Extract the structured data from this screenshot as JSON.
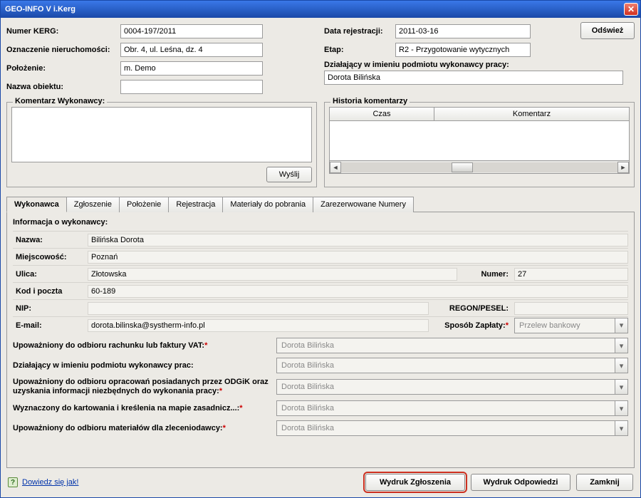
{
  "title": "GEO-INFO V i.Kerg",
  "buttons": {
    "refresh": "Odśwież",
    "send": "Wyślij",
    "print_report": "Wydruk Zgłoszenia",
    "print_reply": "Wydruk Odpowiedzi",
    "close": "Zamknij",
    "help": "Dowiedz się jak!"
  },
  "labels": {
    "numer_kerg": "Numer KERG:",
    "oznaczenie": "Oznaczenie nieruchomości:",
    "polozenie": "Położenie:",
    "nazwa_obiektu": "Nazwa obiektu:",
    "data_rej": "Data rejestracji:",
    "etap": "Etap:",
    "dzialajacy": "Działający w imieniu podmiotu wykonawcy pracy:",
    "komentarz_wyk": "Komentarz Wykonawcy:",
    "historia": "Historia komentarzy",
    "czas": "Czas",
    "komentarz": "Komentarz"
  },
  "values": {
    "numer_kerg": "0004-197/2011",
    "oznaczenie": "Obr. 4, ul. Leśna, dz. 4",
    "polozenie": "m. Demo",
    "nazwa_obiektu": "",
    "data_rej": "2011-03-16",
    "etap": "R2 - Przygotowanie wytycznych",
    "dzialajacy": "Dorota Bilińska"
  },
  "tabs": {
    "wykonawca": "Wykonawca",
    "zgloszenie": "Zgłoszenie",
    "polozenie": "Położenie",
    "rejestracja": "Rejestracja",
    "materialy": "Materiały do pobrania",
    "numery": "Zarezerwowane Numery"
  },
  "info": {
    "section": "Informacja o wykonawcy:",
    "lbl_nazwa": "Nazwa:",
    "lbl_miejsc": "Miejscowość:",
    "lbl_ulica": "Ulica:",
    "lbl_numer": "Numer:",
    "lbl_kod": "Kod i poczta",
    "lbl_nip": "NIP:",
    "lbl_regon": "REGON/PESEL:",
    "lbl_email": "E-mail:",
    "lbl_zaplata": "Sposób Zapłaty:",
    "nazwa": "Bilińska Dorota",
    "miejsc": "Poznań",
    "ulica": "Złotowska",
    "numer": "27",
    "kod": "60-189",
    "nip": "",
    "regon": "",
    "email": "dorota.bilinska@systherm-info.pl",
    "zaplata": "Przelew bankowy"
  },
  "auth": {
    "l1": "Upoważniony do odbioru rachunku lub faktury VAT:",
    "l2": "Działający w imieniu podmiotu wykonawcy prac:",
    "l3": "Upoważniony do odbioru opracowań posiadanych przez ODGiK oraz uzyskania informacji niezbędnych do wykonania pracy:",
    "l4": "Wyznaczony do kartowania i kreślenia na mapie zasadnicz...:",
    "l5": "Upoważniony do odbioru materiałów dla zleceniodawcy:",
    "v": "Dorota Bilińska"
  }
}
